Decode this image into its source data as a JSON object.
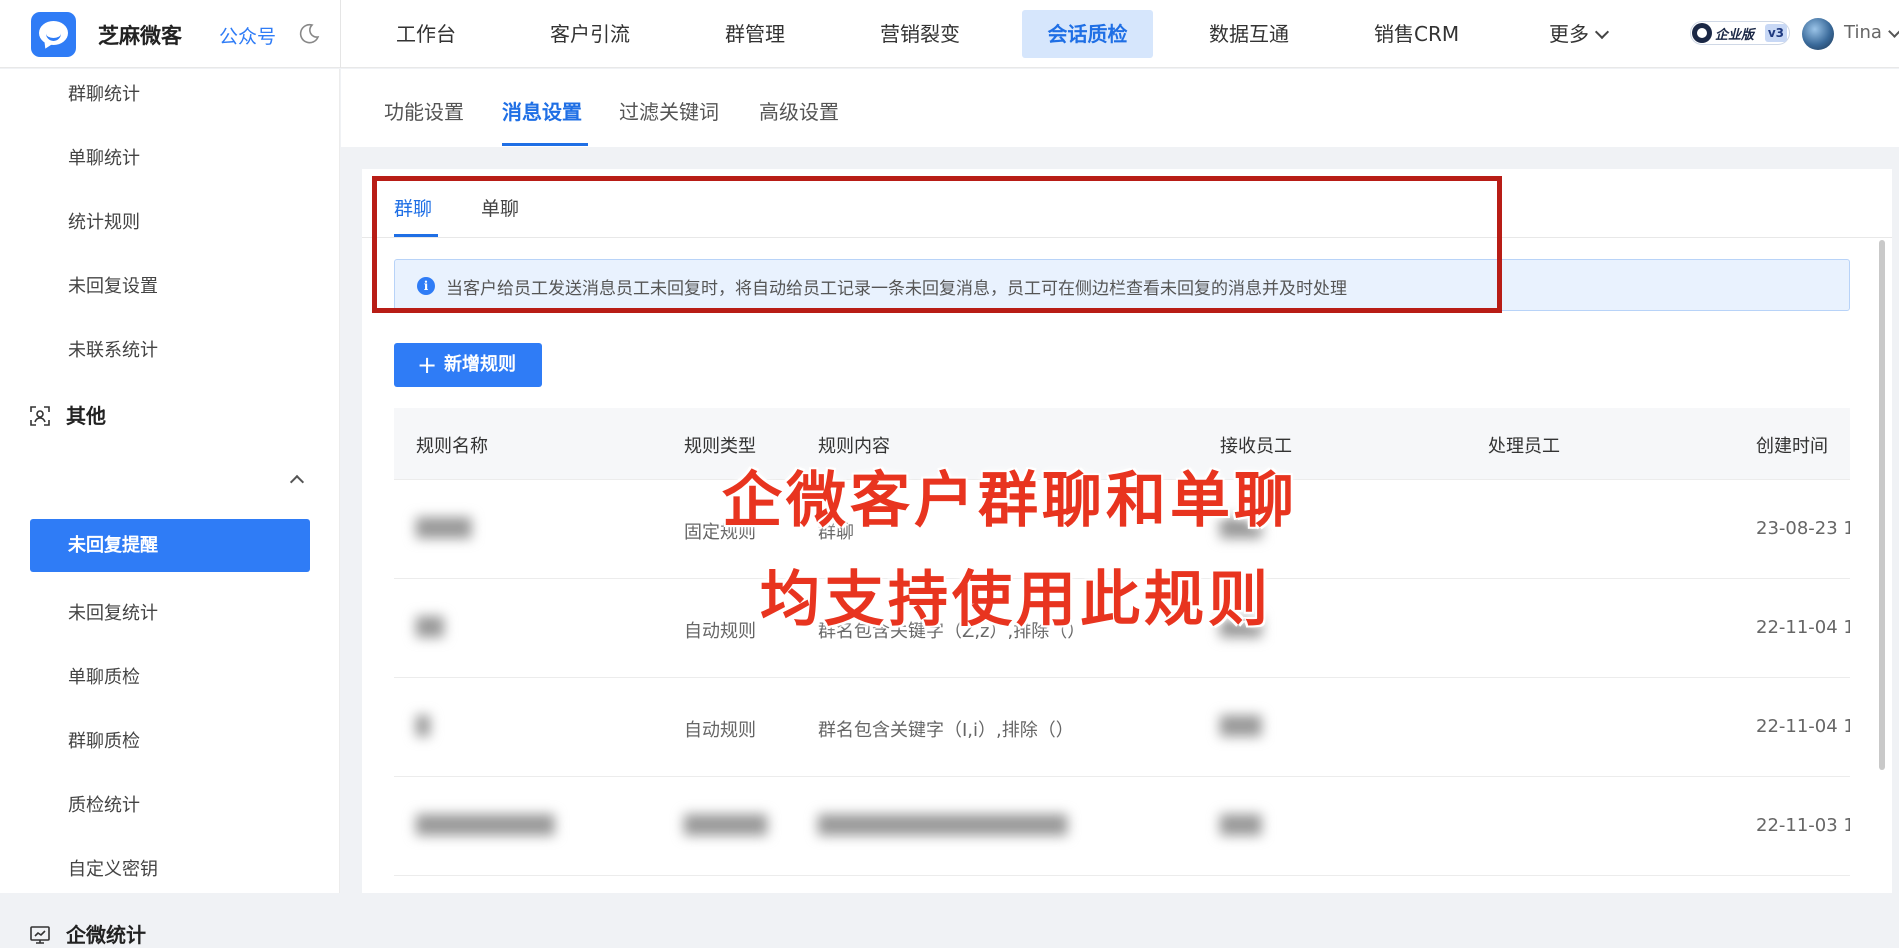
{
  "app": {
    "brand": "芝麻微客",
    "gzh": "公众号",
    "edition_badge": "企业版",
    "edition_version": "v3",
    "user_name": "Tina"
  },
  "top_nav": [
    {
      "label": "工作台"
    },
    {
      "label": "客户引流"
    },
    {
      "label": "群管理"
    },
    {
      "label": "营销裂变"
    },
    {
      "label": "会话质检",
      "active": true
    },
    {
      "label": "数据互通"
    },
    {
      "label": "销售CRM"
    },
    {
      "label": "更多"
    }
  ],
  "sidebar": {
    "items_top": [
      "群聊统计",
      "单聊统计",
      "统计规则",
      "未回复设置",
      "未联系统计"
    ],
    "group_other": "其他",
    "active_item": "未回复提醒",
    "items_bottom": [
      "未回复统计",
      "单聊质检",
      "群聊质检",
      "质检统计",
      "自定义密钥"
    ],
    "group_stats": "企微统计"
  },
  "sub_tabs": [
    "功能设置",
    "消息设置",
    "过滤关键词",
    "高级设置"
  ],
  "inner_tabs": [
    "群聊",
    "单聊"
  ],
  "alert_text": "当客户给员工发送消息员工未回复时，将自动给员工记录一条未回复消息，员工可在侧边栏查看未回复的消息并及时处理",
  "add_button": "新增规则",
  "table": {
    "headers": [
      "规则名称",
      "规则类型",
      "规则内容",
      "接收员工",
      "处理员工",
      "创建时间"
    ],
    "rows": [
      {
        "name": "████",
        "type": "固定规则",
        "content": "群聊",
        "receiver": "███",
        "time": "23-08-23 1("
      },
      {
        "name": "██",
        "type": "自动规则",
        "content": "群名包含关键字（Z,z）,排除（）",
        "receiver": "███",
        "time": "22-11-04 1:"
      },
      {
        "name": "█",
        "type": "自动规则",
        "content": "群名包含关键字（I,i）,排除（）",
        "receiver": "███",
        "time": "22-11-04 1:"
      },
      {
        "name": "██████████",
        "type": "██████",
        "content": "██████████████████",
        "receiver": "███",
        "time": "22-11-03 1"
      }
    ]
  },
  "caption": {
    "line1": "企微客户群聊和单聊",
    "line2": "均支持使用此规则"
  },
  "colors": {
    "accent": "#2f7cf6",
    "caption_red": "#e8341f",
    "frame_red": "#b81d16"
  }
}
